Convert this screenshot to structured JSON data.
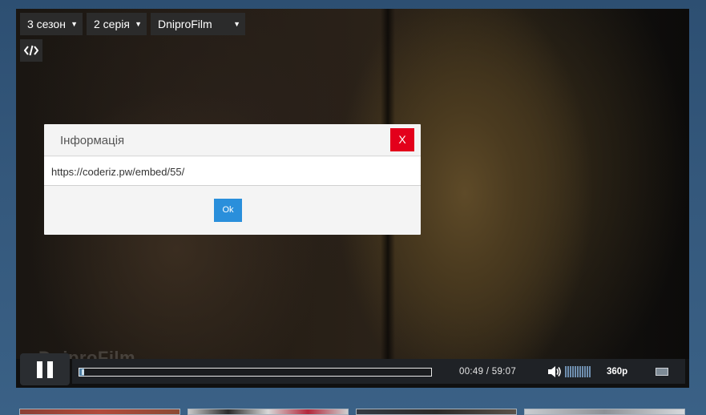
{
  "player": {
    "season_select": "3 сезон",
    "episode_select": "2 серія",
    "voice_select": "DniproFilm",
    "watermark": "DniproFilm"
  },
  "modal": {
    "title": "Інформація",
    "close_label": "X",
    "url": "https://coderiz.pw/embed/55/",
    "ok_label": "Ok"
  },
  "controls": {
    "time": "00:49 / 59:07",
    "quality": "360p",
    "progress_fraction": 0.014,
    "volume_level_fraction": 1.0
  },
  "icons": {
    "embed": "code-icon",
    "pause": "pause-icon",
    "volume": "volume-icon",
    "fullscreen": "fullscreen-icon",
    "dropdown": "triangle-down-icon"
  },
  "colors": {
    "modal_close": "#e3001b",
    "modal_ok": "#2a8fdb",
    "progress_fill": "#4f7fa4",
    "page_background": "#35597d"
  }
}
